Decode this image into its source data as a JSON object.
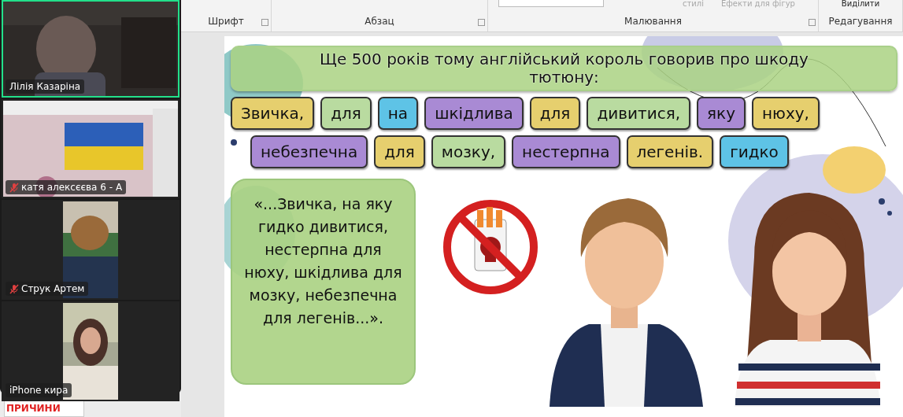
{
  "video_tiles": [
    {
      "name": "Лілія Казаріна",
      "muted": false,
      "active_speaker": true,
      "kind": "wide"
    },
    {
      "name": "катя алексєєва 6 - А",
      "muted": true,
      "active_speaker": false,
      "kind": "wide"
    },
    {
      "name": "Струк Артем",
      "muted": true,
      "active_speaker": false,
      "kind": "narrow"
    },
    {
      "name": "iPhone кира",
      "muted": false,
      "active_speaker": false,
      "kind": "narrow"
    }
  ],
  "slide_thumbnail": {
    "title": "ПРИЧИНИ"
  },
  "ribbon": {
    "top_items": [
      {
        "label": "стилі",
        "disabled": true
      },
      {
        "label": "Ефекти для фігур",
        "disabled": true
      },
      {
        "label": "Виділити",
        "disabled": false
      }
    ],
    "groups": [
      "Шрифт",
      "Абзац",
      "Малювання",
      "Редагування"
    ]
  },
  "slide": {
    "title": "Ще 500 років тому англійський король говорив про шкоду тютюну:",
    "word_rows": [
      [
        {
          "text": "Звичка,",
          "color": "#e6cf6e"
        },
        {
          "text": "для",
          "color": "#b9dba0"
        },
        {
          "text": "на",
          "color": "#5ec3e6"
        },
        {
          "text": "шкідлива",
          "color": "#a98ad4"
        },
        {
          "text": "для",
          "color": "#e6cf6e"
        },
        {
          "text": "дивитися,",
          "color": "#b9dba0"
        },
        {
          "text": "яку",
          "color": "#a98ad4"
        },
        {
          "text": "нюху,",
          "color": "#e6cf6e"
        }
      ],
      [
        {
          "text": "небезпечна",
          "color": "#a98ad4"
        },
        {
          "text": "для",
          "color": "#e6cf6e"
        },
        {
          "text": "мозку,",
          "color": "#b9dba0"
        },
        {
          "text": "нестерпна",
          "color": "#a98ad4"
        },
        {
          "text": "легенів.",
          "color": "#e6cf6e"
        },
        {
          "text": "гидко",
          "color": "#5ec3e6"
        }
      ]
    ],
    "quote": "«...Звичка, на яку гидко дивитися, нестерпна для нюху, шкідлива для мозку, небезпечна для легенів...»."
  }
}
